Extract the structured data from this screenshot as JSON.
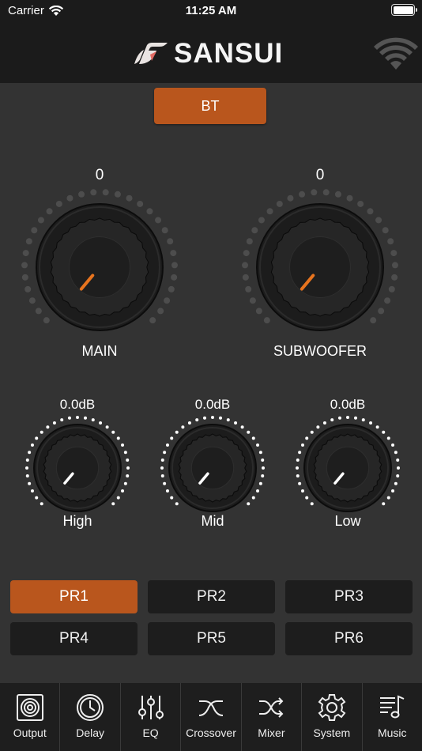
{
  "status_bar": {
    "carrier": "Carrier",
    "time": "11:25 AM",
    "wifi_icon": "wifi-icon",
    "battery_icon": "battery-icon"
  },
  "header": {
    "brand": "SANSUI",
    "logo_icon": "sansui-logo-icon",
    "connection_icon": "wifi-disconnected-icon"
  },
  "source": {
    "label": "BT"
  },
  "volume": {
    "main": {
      "value": "0",
      "label": "MAIN"
    },
    "subwoofer": {
      "value": "0",
      "label": "SUBWOOFER"
    }
  },
  "tone": {
    "high": {
      "value": "0.0dB",
      "label": "High"
    },
    "mid": {
      "value": "0.0dB",
      "label": "Mid"
    },
    "low": {
      "value": "0.0dB",
      "label": "Low"
    }
  },
  "presets": [
    {
      "label": "PR1",
      "active": true
    },
    {
      "label": "PR2",
      "active": false
    },
    {
      "label": "PR3",
      "active": false
    },
    {
      "label": "PR4",
      "active": false
    },
    {
      "label": "PR5",
      "active": false
    },
    {
      "label": "PR6",
      "active": false
    }
  ],
  "tabs": [
    {
      "label": "Output",
      "icon": "speaker-icon"
    },
    {
      "label": "Delay",
      "icon": "clock-icon"
    },
    {
      "label": "EQ",
      "icon": "sliders-icon"
    },
    {
      "label": "Crossover",
      "icon": "crossover-icon"
    },
    {
      "label": "Mixer",
      "icon": "shuffle-icon"
    },
    {
      "label": "System",
      "icon": "gear-icon"
    },
    {
      "label": "Music",
      "icon": "music-icon"
    }
  ],
  "colors": {
    "accent": "#b9561d",
    "background": "#333333",
    "bar": "#1b1b1b",
    "led_off": "#4d4d4d",
    "pointer_big": "#e8741e",
    "pointer_small": "#ffffff"
  }
}
